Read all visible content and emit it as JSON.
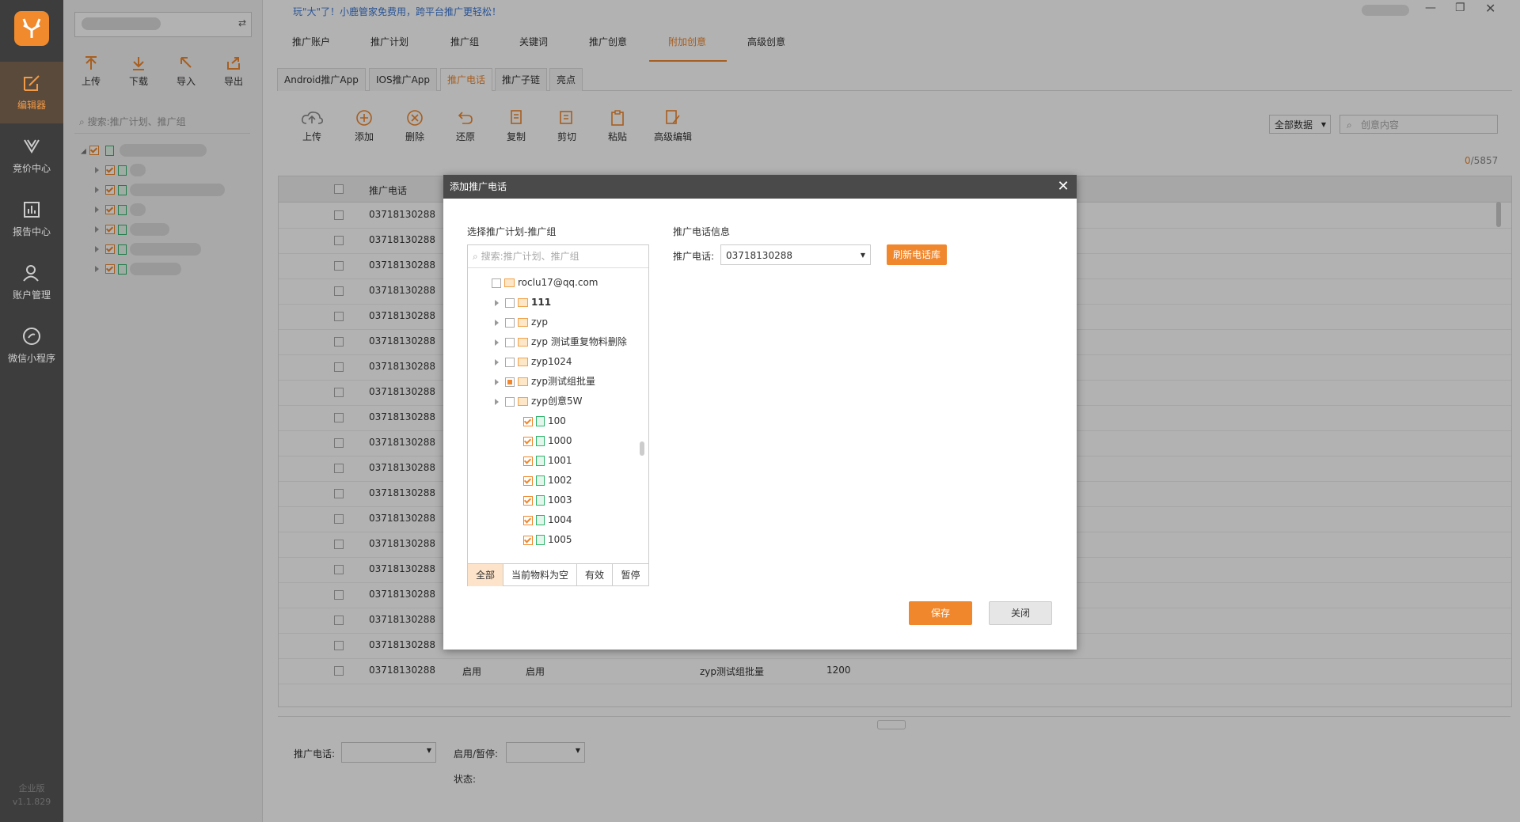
{
  "nav": {
    "items": [
      {
        "label": "编辑器",
        "icon": "edit-icon",
        "active": true
      },
      {
        "label": "竞价中心",
        "icon": "bid-icon"
      },
      {
        "label": "报告中心",
        "icon": "report-icon"
      },
      {
        "label": "账户管理",
        "icon": "user-icon"
      },
      {
        "label": "微信小程序",
        "icon": "wechat-icon"
      }
    ],
    "edition": "企业版",
    "version": "v1.1.829"
  },
  "sidebar": {
    "toolbar": {
      "upload": "上传",
      "download": "下载",
      "import": "导入",
      "export": "导出"
    },
    "search_placeholder": "搜索:推广计划、推广组"
  },
  "slogan": "玩\"大\"了！小鹿管家免费用，跨平台推广更轻松！",
  "top_tabs": [
    "推广账户",
    "推广计划",
    "推广组",
    "关键词",
    "推广创意",
    "附加创意",
    "高级创意"
  ],
  "top_tab_active": "附加创意",
  "sub_tabs": [
    "Android推广App",
    "IOS推广App",
    "推广电话",
    "推广子链",
    "亮点"
  ],
  "sub_tab_active": "推广电话",
  "operations": {
    "upload": "上传",
    "add": "添加",
    "delete": "删除",
    "restore": "还原",
    "copy": "复制",
    "cut": "剪切",
    "paste": "粘贴",
    "advanced": "高级编辑"
  },
  "filter": {
    "select": "全部数据",
    "search_placeholder": "创意内容"
  },
  "count": {
    "current": "0",
    "total": "/5857"
  },
  "table": {
    "header": "推广电话",
    "phone": "03718130288",
    "last_row": {
      "phone": "03718130288",
      "status1": "启用",
      "status2": "启用",
      "group": "zyp测试组批量",
      "number": "1200"
    }
  },
  "bottom": {
    "phone_label": "推广电话:",
    "enable_label": "启用/暂停:",
    "state_label": "状态:"
  },
  "dialog": {
    "title": "添加推广电话",
    "left_title": "选择推广计划-推广组",
    "search_placeholder": "搜索:推广计划、推广组",
    "tree": {
      "account": "roclu17@qq.com",
      "plans": [
        "111",
        "zyp",
        "zyp 测试重复物料删除",
        "zyp1024",
        "zyp测试组批量",
        "zyp创意5W"
      ],
      "groups": [
        "100",
        "1000",
        "1001",
        "1002",
        "1003",
        "1004",
        "1005"
      ]
    },
    "filters": [
      "全部",
      "当前物料为空",
      "有效",
      "暂停"
    ],
    "right_title": "推广电话信息",
    "phone_label": "推广电话:",
    "phone_value": "03718130288",
    "refresh": "刷新电话库",
    "save": "保存",
    "close": "关闭"
  },
  "colors": {
    "accent": "#f0872d",
    "nav_bg": "#3d3d3d",
    "link": "#3a78d6"
  }
}
